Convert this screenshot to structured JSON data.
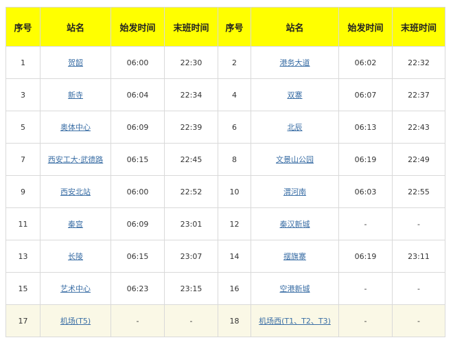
{
  "table": {
    "headers": [
      "序号",
      "站名",
      "始发时间",
      "末班时间",
      "序号",
      "站名",
      "始发时间",
      "末班时间"
    ],
    "rows": [
      [
        {
          "no": "1",
          "name": "贺韶",
          "first": "06:00",
          "last": "22:30"
        },
        {
          "no": "2",
          "name": "港务大道",
          "first": "06:02",
          "last": "22:32"
        }
      ],
      [
        {
          "no": "3",
          "name": "新寺",
          "first": "06:04",
          "last": "22:34"
        },
        {
          "no": "4",
          "name": "双寨",
          "first": "06:07",
          "last": "22:37"
        }
      ],
      [
        {
          "no": "5",
          "name": "奥体中心",
          "first": "06:09",
          "last": "22:39"
        },
        {
          "no": "6",
          "name": "北辰",
          "first": "06:13",
          "last": "22:43"
        }
      ],
      [
        {
          "no": "7",
          "name": "西安工大·武德路",
          "first": "06:15",
          "last": "22:45"
        },
        {
          "no": "8",
          "name": "文景山公园",
          "first": "06:19",
          "last": "22:49"
        }
      ],
      [
        {
          "no": "9",
          "name": "西安北站",
          "first": "06:00",
          "last": "22:52"
        },
        {
          "no": "10",
          "name": "渭河南",
          "first": "06:03",
          "last": "22:55"
        }
      ],
      [
        {
          "no": "11",
          "name": "秦宫",
          "first": "06:09",
          "last": "23:01"
        },
        {
          "no": "12",
          "name": "秦汉新城",
          "first": "-",
          "last": "-"
        }
      ],
      [
        {
          "no": "13",
          "name": "长陵",
          "first": "06:15",
          "last": "23:07"
        },
        {
          "no": "14",
          "name": "摆旗寨",
          "first": "06:19",
          "last": "23:11"
        }
      ],
      [
        {
          "no": "15",
          "name": "艺术中心",
          "first": "06:23",
          "last": "23:15"
        },
        {
          "no": "16",
          "name": "空港新城",
          "first": "-",
          "last": "-"
        }
      ],
      [
        {
          "no": "17",
          "name": "机场(T5)",
          "first": "-",
          "last": "-"
        },
        {
          "no": "18",
          "name": "机场西(T1、T2、T3)",
          "first": "-",
          "last": "-"
        }
      ]
    ],
    "colors": {
      "header_bg": "#ffff00",
      "link": "#3a6ea5",
      "highlight_row_bg": "#faf8e6",
      "border": "#d9d9d9"
    }
  }
}
